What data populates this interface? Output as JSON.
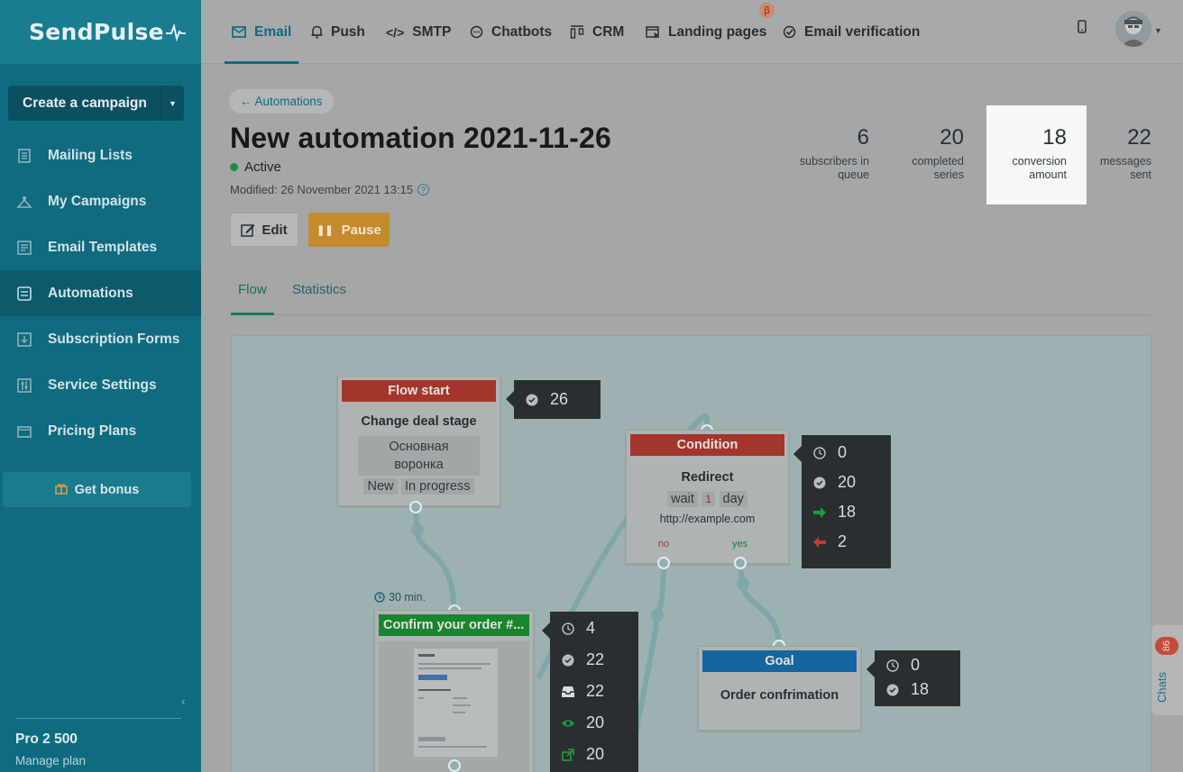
{
  "sidebar": {
    "logo": "SendPulse",
    "create_campaign": "Create a campaign",
    "items": [
      {
        "label": "Mailing Lists",
        "icon": "list-book-icon"
      },
      {
        "label": "My Campaigns",
        "icon": "campaign-icon"
      },
      {
        "label": "Email Templates",
        "icon": "template-icon"
      },
      {
        "label": "Automations",
        "icon": "automation-icon",
        "active": true
      },
      {
        "label": "Subscription Forms",
        "icon": "form-icon"
      },
      {
        "label": "Service Settings",
        "icon": "settings-sliders-icon"
      },
      {
        "label": "Pricing Plans",
        "icon": "wallet-icon"
      }
    ],
    "bonus": "Get bonus",
    "plan_name": "Pro 2 500",
    "plan_manage": "Manage plan"
  },
  "topnav": {
    "tabs": [
      {
        "label": "Email",
        "icon": "envelope-icon",
        "active": true
      },
      {
        "label": "Push",
        "icon": "bell-icon"
      },
      {
        "label": "SMTP",
        "icon": "code-icon"
      },
      {
        "label": "Chatbots",
        "icon": "chat-icon"
      },
      {
        "label": "CRM",
        "icon": "crm-icon"
      },
      {
        "label": "Landing pages",
        "icon": "landing-icon"
      },
      {
        "label": "Email verification",
        "icon": "verify-icon"
      }
    ],
    "beta": "β"
  },
  "page": {
    "breadcrumb": "← Automations",
    "title": "New automation 2021-11-26",
    "status": "Active",
    "modified": "Modified: 26 November 2021 13:15",
    "edit": "Edit",
    "pause": "Pause"
  },
  "stats": [
    {
      "value": "6",
      "label1": "subscribers in",
      "label2": "queue"
    },
    {
      "value": "20",
      "label1": "completed",
      "label2": "series"
    },
    {
      "value": "18",
      "label1": "conversion",
      "label2": "amount"
    },
    {
      "value": "22",
      "label1": "messages",
      "label2": "sent"
    }
  ],
  "flow_tabs": {
    "flow": "Flow",
    "statistics": "Statistics"
  },
  "nodes": {
    "start": {
      "head": "Flow start",
      "title": "Change deal stage",
      "chip1": "Основная воронка",
      "chip2": "New",
      "chip3": "In progress",
      "count": "26"
    },
    "condition": {
      "head": "Condition",
      "title": "Redirect",
      "wait": "wait",
      "wait_num": "1",
      "wait_unit": "day",
      "url": "http://example.com",
      "no": "no",
      "yes": "yes",
      "s_wait": "0",
      "s_done": "20",
      "s_yes": "18",
      "s_no": "2"
    },
    "email": {
      "delay": "30 min.",
      "head": "Confirm your order #...",
      "s_wait": "4",
      "s_done": "22",
      "s_delivered": "22",
      "s_opened": "20",
      "s_clicked": "20"
    },
    "goal": {
      "head": "Goal",
      "title": "Order confrimation",
      "s_wait": "0",
      "s_done": "18"
    }
  },
  "chats": {
    "badge": "86",
    "label": "Chats"
  }
}
